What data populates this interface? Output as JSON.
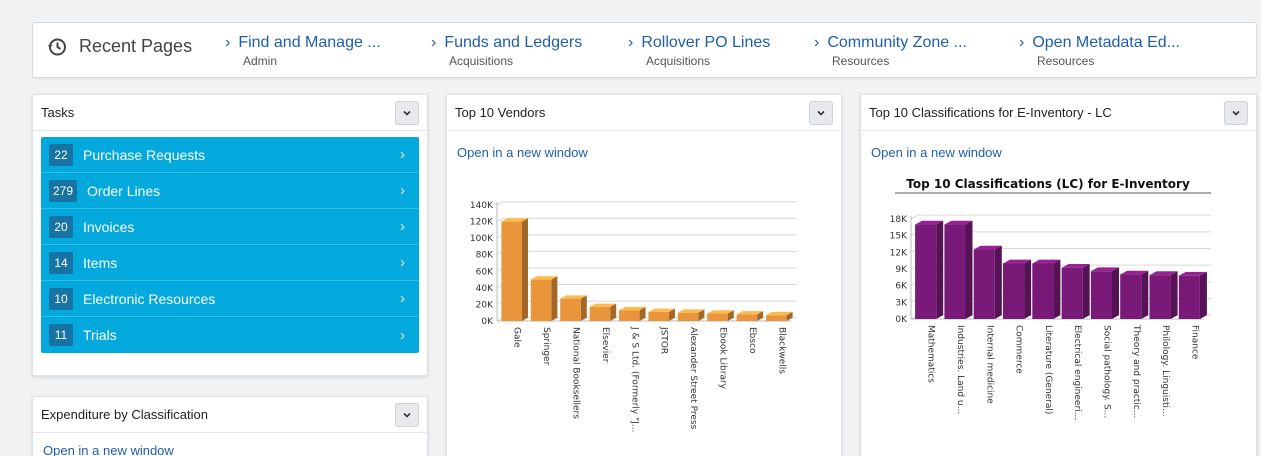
{
  "recent_pages": {
    "title": "Recent Pages",
    "items": [
      {
        "label": "Find and Manage ...",
        "sub": "Admin"
      },
      {
        "label": "Funds and Ledgers",
        "sub": "Acquisitions"
      },
      {
        "label": "Rollover PO Lines",
        "sub": "Acquisitions"
      },
      {
        "label": "Community Zone ...",
        "sub": "Resources"
      },
      {
        "label": "Open Metadata Ed...",
        "sub": "Resources"
      }
    ]
  },
  "tasks": {
    "title": "Tasks",
    "items": [
      {
        "count": "22",
        "label": "Purchase Requests"
      },
      {
        "count": "279",
        "label": "Order Lines"
      },
      {
        "count": "20",
        "label": "Invoices"
      },
      {
        "count": "14",
        "label": "Items"
      },
      {
        "count": "10",
        "label": "Electronic Resources"
      },
      {
        "count": "11",
        "label": "Trials"
      }
    ]
  },
  "expenditure": {
    "title": "Expenditure by Classification",
    "open_link": "Open in a new window"
  },
  "vendors": {
    "title": "Top 10 Vendors",
    "open_link": "Open in a new window"
  },
  "classifications": {
    "title": "Top 10 Classifications for E-Inventory - LC",
    "open_link": "Open in a new window"
  },
  "colors": {
    "accent": "#03a9dc",
    "badge": "#1673a4",
    "link": "#1f5fa8",
    "vendor_bar": "#e8953c",
    "class_bar": "#7a1a78"
  },
  "icons": {
    "recent": "history-icon",
    "item_arrow": "chevron-right-icon",
    "collapse": "chevron-down-icon"
  },
  "chart_data": [
    {
      "type": "bar",
      "title": "",
      "categories": [
        "Gale",
        "Springer",
        "National Booksellers",
        "Elsevier",
        "J & S Ltd. (Formerly \"J...",
        "JSTOR",
        "Alexander Street Press",
        "Ebook Library",
        "Ebsco",
        "Blackwells"
      ],
      "values": [
        120000,
        50000,
        27000,
        17000,
        13000,
        11000,
        10000,
        9000,
        8000,
        7000
      ],
      "ylim": [
        0,
        140000
      ],
      "yticks": [
        "0K",
        "20K",
        "40K",
        "60K",
        "80K",
        "100K",
        "120K",
        "140K"
      ],
      "grid": true,
      "legend": "none"
    },
    {
      "type": "bar",
      "title": "Top 10 Classifications (LC) for E-Inventory",
      "categories": [
        "Mathematics",
        "Industries. Land u...",
        "Internal medicine",
        "Commerce",
        "Literature (General)",
        "Electrical engineeri...",
        "Social pathology. S...",
        "Theory and practic...",
        "Philology. Linguisti...",
        "Finance"
      ],
      "values": [
        17000,
        17000,
        12500,
        10000,
        10000,
        9200,
        8600,
        8000,
        7900,
        7800
      ],
      "ylim": [
        0,
        18000
      ],
      "yticks": [
        "0K",
        "3K",
        "6K",
        "9K",
        "12K",
        "15K",
        "18K"
      ],
      "grid": true,
      "legend": "none"
    }
  ]
}
